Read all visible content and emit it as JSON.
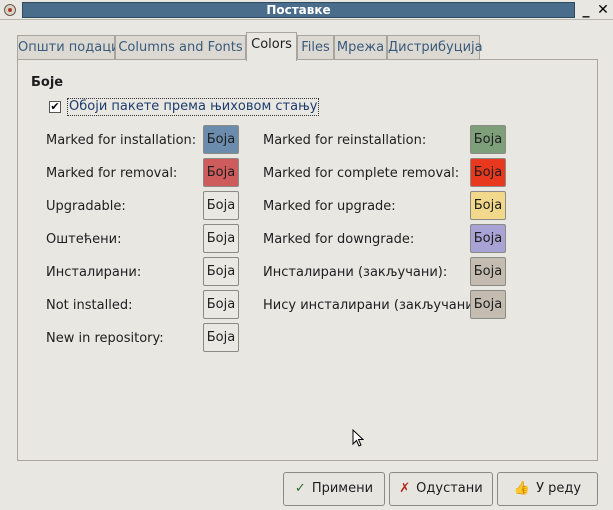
{
  "window": {
    "title": "Поставке"
  },
  "tabs": [
    {
      "label": "Општи подаци"
    },
    {
      "label": "Columns and Fonts"
    },
    {
      "label": "Colors"
    },
    {
      "label": "Files"
    },
    {
      "label": "Мрежа"
    },
    {
      "label": "Дистрибуција"
    }
  ],
  "active_tab": "Colors",
  "section": {
    "title": "Боје",
    "checkbox": {
      "label": "Обоји пакете према њиховом стању",
      "checked": true,
      "mark": "✔"
    }
  },
  "color_button_label": "Боја",
  "left_rows": [
    {
      "label": "Marked for installation:",
      "color": "#6b8cad"
    },
    {
      "label": "Marked for removal:",
      "color": "#cf5c5c"
    },
    {
      "label": "Upgradable:",
      "color": "#eae8e3"
    },
    {
      "label": "Оштећени:",
      "color": "#eae8e3"
    },
    {
      "label": "Инсталирани:",
      "color": "#eae8e3"
    },
    {
      "label": "Not installed:",
      "color": "#eae8e3"
    },
    {
      "label": "New in repository:",
      "color": "#eae8e3"
    }
  ],
  "right_rows": [
    {
      "label": "Marked for reinstallation:",
      "color": "#7da07a"
    },
    {
      "label": "Marked for complete removal:",
      "color": "#e8391f"
    },
    {
      "label": "Marked for upgrade:",
      "color": "#f1d88b"
    },
    {
      "label": "Marked for downgrade:",
      "color": "#a7a3d4"
    },
    {
      "label": "Инсталирани (закључани):",
      "color": "#c4bcb1"
    },
    {
      "label": "Нису инсталирани (закључани):",
      "color": "#c4bcb1"
    }
  ],
  "buttons": {
    "apply": {
      "label": "Примени",
      "icon": "checkmark-icon",
      "glyph": "✓"
    },
    "cancel": {
      "label": "Одустани",
      "icon": "cancel-x-icon",
      "glyph": "✗"
    },
    "ok": {
      "label": "У реду",
      "icon": "thumbs-up-icon",
      "glyph": "👍"
    }
  }
}
